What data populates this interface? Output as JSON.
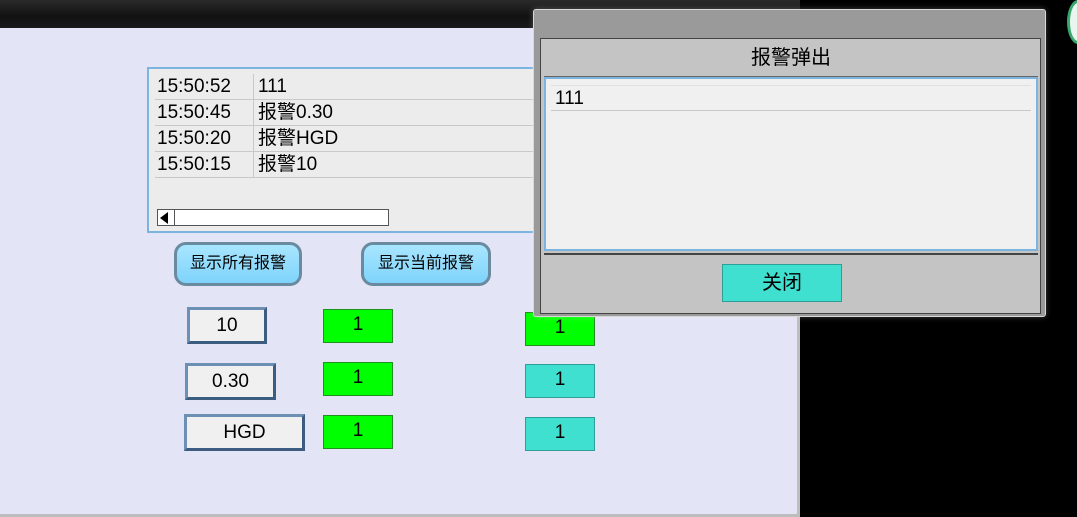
{
  "alarm_list": {
    "rows": [
      {
        "time": "15:50:52",
        "message": "111"
      },
      {
        "time": "15:50:45",
        "message": "报警0.30"
      },
      {
        "time": "15:50:20",
        "message": "报警HGD"
      },
      {
        "time": "15:50:15",
        "message": "报警10"
      }
    ]
  },
  "buttons": {
    "show_all": "显示所有报警",
    "show_current": "显示当前报警"
  },
  "values": [
    {
      "label": "10",
      "indicator1": "1",
      "indicator2": "1",
      "indicator1_color": "#00ff00",
      "indicator2_color": "#00ff00"
    },
    {
      "label": "0.30",
      "indicator1": "1",
      "indicator2": "1",
      "indicator1_color": "#00ff00",
      "indicator2_color": "#40e0d0"
    },
    {
      "label": "HGD",
      "indicator1": "1",
      "indicator2": "1",
      "indicator1_color": "#00ff00",
      "indicator2_color": "#40e0d0"
    }
  ],
  "popup": {
    "title": "报警弹出",
    "rows": [
      "111"
    ],
    "close_label": "关闭"
  },
  "colors": {
    "window_bg": "#e4e4f7",
    "accent_green": "#00ff00",
    "accent_teal": "#40e0d0",
    "button_blue": "#7fd3fb"
  }
}
